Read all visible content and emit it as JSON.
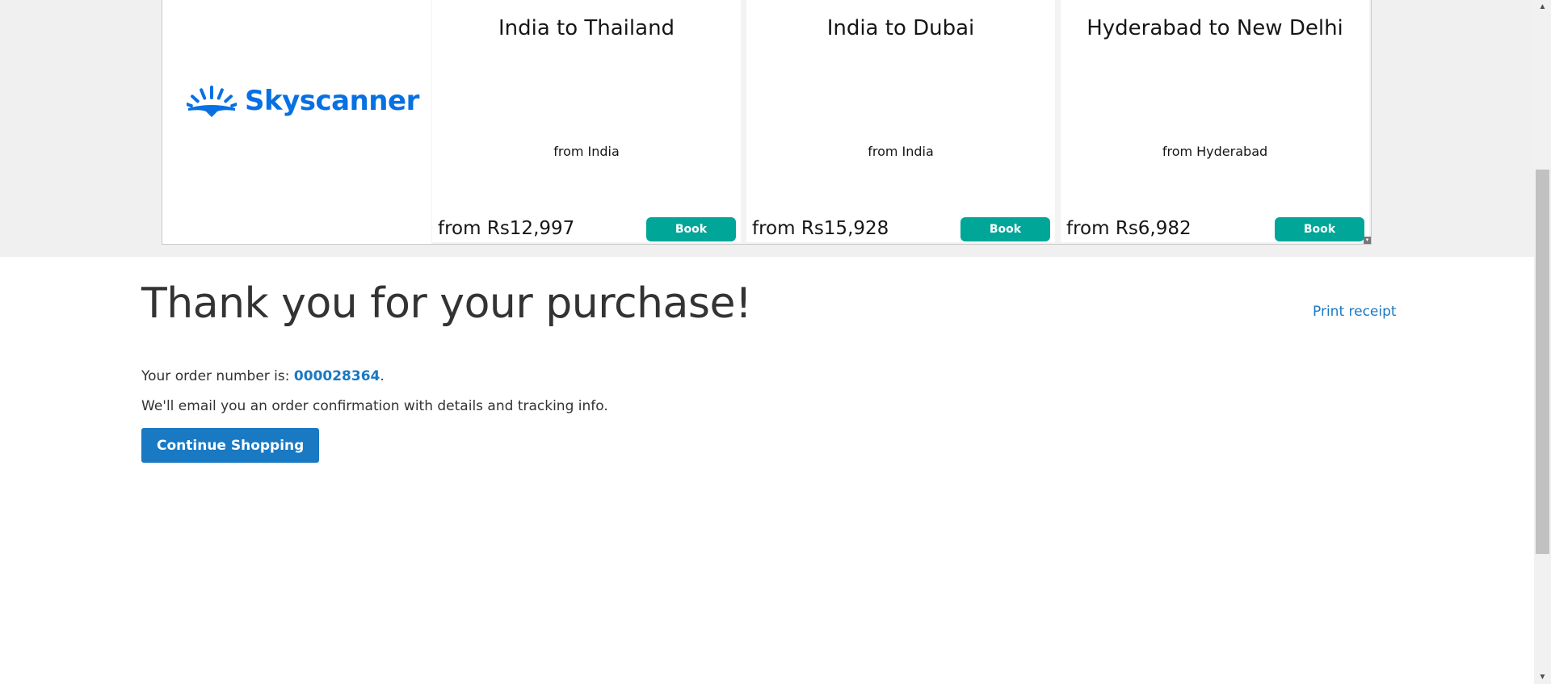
{
  "ad": {
    "brand": "Skyscanner",
    "brand_color": "#0770e3",
    "button_color": "#00a698",
    "cards": [
      {
        "destination": "India to Thailand",
        "origin": "from India",
        "price": "from Rs12,997",
        "button": "Book"
      },
      {
        "destination": "India to Dubai",
        "origin": "from India",
        "price": "from Rs15,928",
        "button": "Book"
      },
      {
        "destination": "Hyderabad to New Delhi",
        "origin": "from Hyderabad",
        "price": "from Rs6,982",
        "button": "Book"
      }
    ],
    "corner_icon": "adchoices-icon"
  },
  "main": {
    "title": "Thank you for your purchase!",
    "print_receipt": "Print receipt",
    "order_prefix": "Your order number is: ",
    "order_number": "000028364",
    "order_suffix": ".",
    "email_note": "We'll email you an order confirmation with details and tracking info.",
    "continue_button": "Continue Shopping",
    "link_color": "#1979c3"
  },
  "scrollbar": {
    "up_icon": "scroll-up-arrow-icon",
    "down_icon": "scroll-down-arrow-icon"
  }
}
